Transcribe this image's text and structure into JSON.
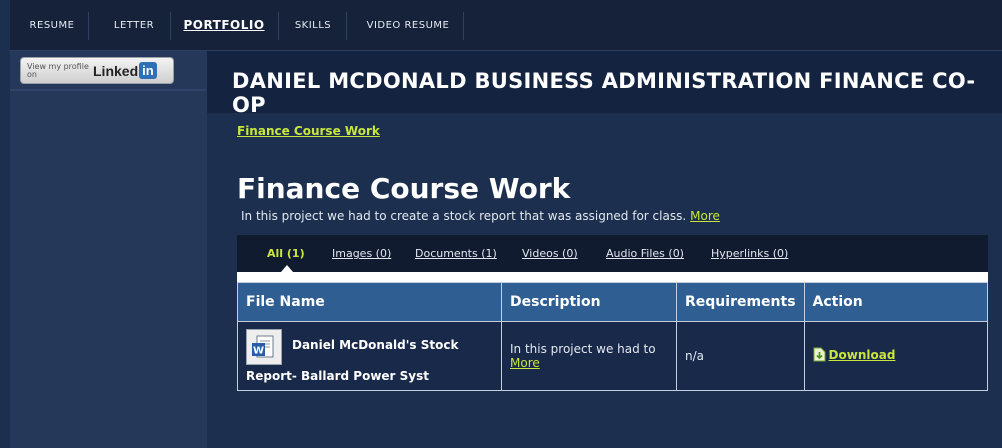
{
  "topnav": {
    "items": [
      "RESUME",
      "LETTER",
      "PORTFOLIO",
      "SKILLS",
      "VIDEO RESUME"
    ],
    "active_index": 2
  },
  "sidebar": {
    "linkedin_view": "View my profile on",
    "linkedin_brand": "Linked",
    "linkedin_in": "in"
  },
  "header": {
    "title": "DANIEL MCDONALD BUSINESS ADMINISTRATION FINANCE CO-OP"
  },
  "breadcrumb": "Finance Course Work",
  "page": {
    "title": "Finance Course Work",
    "description": "In this project we had to create a stock report that was assigned for class.",
    "more_label": "More"
  },
  "filters": [
    "All (1)",
    "Images (0)",
    "Documents (1)",
    "Videos (0)",
    "Audio Files (0)",
    "Hyperlinks (0)"
  ],
  "table": {
    "headers": [
      "File Name",
      "Description",
      "Requirements",
      "Action"
    ],
    "rows": [
      {
        "file_line1": "Daniel McDonald's Stock",
        "file_line2": "Report- Ballard Power Syst",
        "description": "In this project we had to",
        "more_label": "More",
        "requirements": "n/a",
        "action": "Download"
      }
    ]
  },
  "colors": {
    "background": "#1d2f4f",
    "accent_link": "#c8e63c",
    "table_header": "#2f5f92"
  }
}
